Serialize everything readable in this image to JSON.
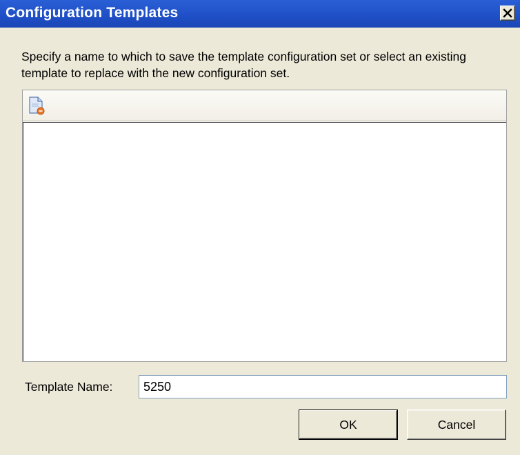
{
  "window": {
    "title": "Configuration Templates",
    "close_icon": "close-icon"
  },
  "instructions": "Specify a name to which to save the template configuration set or select an existing template to replace with the new configuration set.",
  "toolbar": {
    "new_template_icon": "new-template-icon"
  },
  "template_list": {
    "items": []
  },
  "template_name": {
    "label": "Template Name:",
    "value": "5250"
  },
  "buttons": {
    "ok": "OK",
    "cancel": "Cancel"
  },
  "colors": {
    "titlebar": "#1f4fc6",
    "dialog_bg": "#ece9d8",
    "icon_accent": "#e8792a"
  }
}
